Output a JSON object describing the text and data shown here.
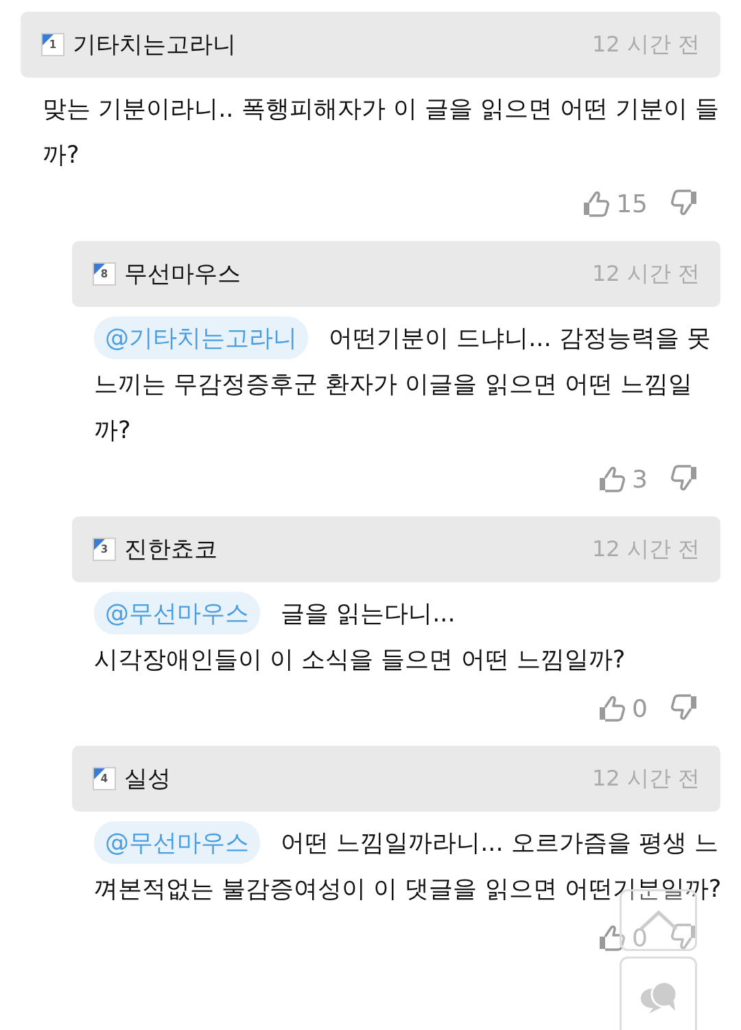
{
  "comments": [
    {
      "kind": "comment",
      "level": "1",
      "author": "기타치는고라니",
      "time": "12 시간 전",
      "text": "맞는 기분이라니.. 폭행피해자가 이 글을 읽으면 어떤 기분이 들까?",
      "likes": "15"
    },
    {
      "kind": "reply",
      "level": "8",
      "author": "무선마우스",
      "time": "12 시간 전",
      "mention": "@기타치는고라니",
      "text": "어떤기분이 드냐니... 감정능력을 못느끼는 무감정증후군 환자가 이글을 읽으면 어떤 느낌일까?",
      "likes": "3"
    },
    {
      "kind": "reply",
      "level": "3",
      "author": "진한쵸코",
      "time": "12 시간 전",
      "mention": "@무선마우스",
      "text": "글을 읽는다니...\n시각장애인들이 이 소식을 들으면 어떤 느낌일까?",
      "likes": "0"
    },
    {
      "kind": "reply",
      "level": "4",
      "author": "실성",
      "time": "12 시간 전",
      "mention": "@무선마우스",
      "text": "어떤 느낌일까라니... 오르가즘을 평생 느껴본적없는 불감증여성이 이 댓글을 읽으면 어떤기분일까?",
      "likes": "0"
    }
  ]
}
